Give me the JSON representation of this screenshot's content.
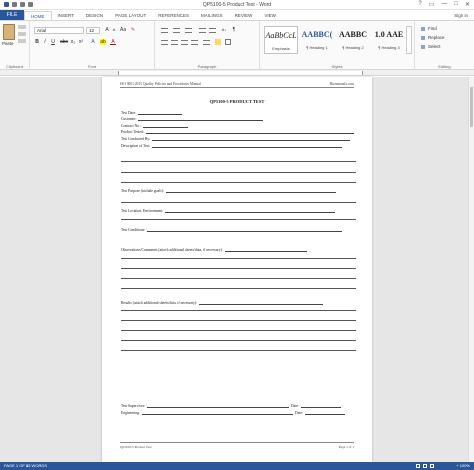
{
  "window": {
    "title": "QP5100-5 Product Test - Word",
    "controls": [
      "?",
      "▭",
      "—",
      "□",
      "✕"
    ]
  },
  "ribbon_tabs": {
    "file": "FILE",
    "tabs": [
      "HOME",
      "INSERT",
      "DESIGN",
      "PAGE LAYOUT",
      "REFERENCES",
      "MAILINGS",
      "REVIEW",
      "VIEW"
    ],
    "active": "HOME",
    "signin": "Sign in"
  },
  "clipboard": {
    "paste": "Paste",
    "label": "Clipboard"
  },
  "font": {
    "name": "Arial",
    "size": "12",
    "label": "Font",
    "bold": "B",
    "italic": "I",
    "underline": "U",
    "grow": "A",
    "shrink": "A",
    "color_a": "A"
  },
  "paragraph": {
    "label": "Paragraph",
    "pilcrow": "¶",
    "sort": "A↓"
  },
  "styles": {
    "label": "Styles",
    "items": [
      {
        "sample": "AaBbCcL",
        "name": "Emphasis"
      },
      {
        "sample": "AABBC(",
        "name": "¶ Heading 1"
      },
      {
        "sample": "AABBC",
        "name": "¶ Heading 2"
      },
      {
        "sample": "1.0 AAE",
        "name": "¶ Heading 3"
      }
    ]
  },
  "editing": {
    "label": "Editing",
    "find": "Find",
    "replace": "Replace",
    "select": "Select"
  },
  "document": {
    "header_left": "ISO 9001:2015 Quality Policies and Procedures Manual",
    "header_right": "Bizmanualz.com",
    "title": "QP5100-5 PRODUCT TEST",
    "fields": [
      "Test Date:",
      "Customer:",
      "Contract No.:",
      "Product Tested:",
      "Test Conducted By:",
      "Description of Test:",
      "Test Purpose (include goals):",
      "Test Location, Environment:",
      "Test Conditions:",
      "Observations/Comments (attach additional sheets/data, if necessary):",
      "Results (attach additional sheets/data, if necessary):",
      "Test Supervisor:",
      "Engineering:"
    ],
    "date_label": "Date:",
    "footer_left": "Qp5100-5 Product Test",
    "footer_right": "Page 1 of 1"
  },
  "status": {
    "page": "PAGE 1 OF 1",
    "words": "45 WORDS",
    "zoom": "+ 100%"
  }
}
